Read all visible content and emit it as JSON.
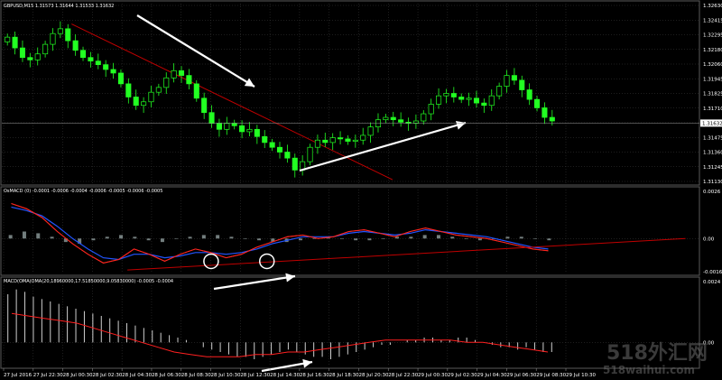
{
  "window": {
    "main_title": "GBPUSD,M15  1.31573 1.31644 1.31533 1.31632",
    "panel2_title": "OsMACD (0) -0.0001 -0.0006 -0.0004 -0.0006 -0.0005 -0.0006 -0.0005",
    "panel3_title": "MACD(OMA(OMA(20,18960000,17.51850000,9.05830000) -0.0005 -0.0004",
    "watermark_cn": "518外汇网",
    "watermark_url": "518waihui.com"
  },
  "colors": {
    "bg": "#000000",
    "grid": "#3c3c3c",
    "candle": "#22ff22",
    "trendline": "#c00000",
    "arrow": "#ffffff",
    "hist": "#9aa8a8",
    "line_red": "#ff2020",
    "line_blue": "#2255ff",
    "line_orange": "#ffa000"
  },
  "chart_data": [
    {
      "type": "candlestick",
      "title": "GBPUSD,M15",
      "y_ticks": [
        "1.32630",
        "1.32415",
        "1.32295",
        "1.32180",
        "1.32060",
        "1.31945",
        "1.31825",
        "1.31710",
        "1.31590",
        "1.31475",
        "1.31360",
        "1.31245",
        "1.31130"
      ],
      "current_price": "1.31632",
      "ylim": [
        1.3113,
        1.3263
      ],
      "x_ticks": [
        "27 Jul 2016",
        "27 Jul 22:30",
        "28 Jul 00:30",
        "28 Jul 02:30",
        "28 Jul 04:30",
        "28 Jul 06:30",
        "28 Jul 08:30",
        "28 Jul 10:30",
        "28 Jul 12:30",
        "28 Jul 14:30",
        "28 Jul 16:30",
        "28 Jul 18:30",
        "28 Jul 20:30",
        "28 Jul 22:30",
        "29 Jul 00:30",
        "29 Jul 02:30",
        "29 Jul 04:30",
        "29 Jul 06:30",
        "29 Jul 08:30",
        "29 Jul 10:30"
      ],
      "close_series": [
        1.3235,
        1.3226,
        1.3218,
        1.3216,
        1.3221,
        1.3229,
        1.3238,
        1.3242,
        1.3232,
        1.3224,
        1.3218,
        1.3215,
        1.3212,
        1.3208,
        1.3205,
        1.3196,
        1.3185,
        1.3178,
        1.3181,
        1.3189,
        1.3193,
        1.3201,
        1.3207,
        1.3203,
        1.3196,
        1.3184,
        1.3172,
        1.3163,
        1.3158,
        1.3163,
        1.3161,
        1.3156,
        1.3158,
        1.3152,
        1.3147,
        1.3143,
        1.3139,
        1.3134,
        1.3124,
        1.3131,
        1.3143,
        1.3149,
        1.3147,
        1.3151,
        1.315,
        1.3148,
        1.3149,
        1.3153,
        1.316,
        1.3166,
        1.3168,
        1.3166,
        1.3164,
        1.3163,
        1.3165,
        1.3171,
        1.3179,
        1.3186,
        1.3188,
        1.3185,
        1.3183,
        1.3184,
        1.318,
        1.3178,
        1.3186,
        1.3194,
        1.3203,
        1.3199,
        1.3191,
        1.3183,
        1.3176,
        1.3168,
        1.3165
      ],
      "trendline": {
        "from": [
          0.1,
          1.3246
        ],
        "to": [
          0.56,
          1.3116
        ]
      },
      "annotations": [
        "arrow-down",
        "arrow-up"
      ]
    },
    {
      "type": "line",
      "title": "OsMACD",
      "y_ticks": [
        "0.0026",
        "0.00",
        "-0.0016"
      ],
      "ylim": [
        -0.002,
        0.0028
      ],
      "hist": [
        0.0002,
        0.0004,
        0.0003,
        0.0001,
        -0.0002,
        -0.0003,
        -0.0001,
        0.0001,
        0.0002,
        0.0001,
        -0.0001,
        -0.0002,
        0.0,
        0.0001,
        0.0002,
        0.0002,
        0.0001,
        0.0,
        -0.0001,
        -0.0002,
        -0.0002,
        -0.0001,
        0.0,
        0.0001,
        0.0,
        -0.0001,
        -0.0001,
        0.0,
        0.0001,
        0.0001,
        0.0002,
        0.0002,
        0.0001,
        0.0,
        -0.0001,
        0.0,
        0.0001,
        0.0001,
        0.0,
        -0.0001
      ],
      "red": [
        0.002,
        0.0017,
        0.0012,
        0.0004,
        -0.0003,
        -0.0009,
        -0.0014,
        -0.0012,
        -0.0006,
        -0.0009,
        -0.0013,
        -0.0009,
        -0.0006,
        -0.0008,
        -0.0011,
        -0.0009,
        -0.0005,
        -0.0002,
        0.0001,
        0.0002,
        0.0,
        0.0001,
        0.0004,
        0.0005,
        0.0003,
        0.0001,
        0.0004,
        0.0006,
        0.0004,
        0.0002,
        0.0001,
        0.0,
        -0.0002,
        -0.0004,
        -0.0006,
        -0.0007
      ],
      "blue": [
        0.0018,
        0.0016,
        0.0013,
        0.0007,
        0.0,
        -0.0006,
        -0.0011,
        -0.0012,
        -0.0009,
        -0.0009,
        -0.0011,
        -0.001,
        -0.0008,
        -0.0008,
        -0.0009,
        -0.0008,
        -0.0006,
        -0.0003,
        -0.0001,
        0.0001,
        0.0001,
        0.0001,
        0.0003,
        0.0004,
        0.0003,
        0.0002,
        0.0003,
        0.0005,
        0.0004,
        0.0003,
        0.0002,
        0.0001,
        -0.0001,
        -0.0003,
        -0.0005,
        -0.0006
      ],
      "support": {
        "from": [
          0.18,
          -0.0018
        ],
        "to": [
          0.98,
          0.0
        ]
      },
      "circles": [
        [
          0.3,
          -0.0013
        ],
        [
          0.38,
          -0.0013
        ]
      ]
    },
    {
      "type": "bar",
      "title": "MACD",
      "y_ticks": [
        "0.0024",
        "0.00"
      ],
      "ylim": [
        -0.001,
        0.0026
      ],
      "hist": [
        0.002,
        0.0022,
        0.0021,
        0.0019,
        0.0018,
        0.0017,
        0.0016,
        0.0015,
        0.0014,
        0.0013,
        0.0012,
        0.0011,
        0.001,
        0.0009,
        0.0008,
        0.0007,
        0.0006,
        0.0005,
        0.0004,
        0.0003,
        0.0002,
        0.0001,
        0.0,
        -0.0002,
        -0.0003,
        -0.0004,
        -0.0005,
        -0.0006,
        -0.0006,
        -0.0007,
        -0.0006,
        -0.0005,
        -0.0004,
        -0.0003,
        -0.0004,
        -0.0005,
        -0.0006,
        -0.0006,
        -0.0007,
        -0.0006,
        -0.0005,
        -0.0004,
        -0.0003,
        -0.0002,
        -0.0001,
        -0.0001,
        0.0,
        0.0001,
        0.0001,
        0.0002,
        0.0002,
        0.0001,
        0.0001,
        0.0002,
        0.0002,
        0.0001,
        0.0,
        -0.0001,
        -0.0002,
        -0.0002,
        -0.0003,
        -0.0002,
        -0.0003,
        -0.0004,
        -0.0004
      ],
      "signal": [
        0.0012,
        0.0011,
        0.001,
        0.0009,
        0.0008,
        0.0006,
        0.0004,
        0.0002,
        0.0,
        -0.0002,
        -0.0004,
        -0.0005,
        -0.0006,
        -0.0006,
        -0.0006,
        -0.0005,
        -0.0005,
        -0.0004,
        -0.0004,
        -0.0003,
        -0.0002,
        -0.0001,
        0.0,
        0.0001,
        0.0001,
        0.0001,
        0.0001,
        0.0001,
        0.0,
        0.0,
        -0.0001,
        -0.0002,
        -0.0003,
        -0.0004
      ]
    }
  ]
}
